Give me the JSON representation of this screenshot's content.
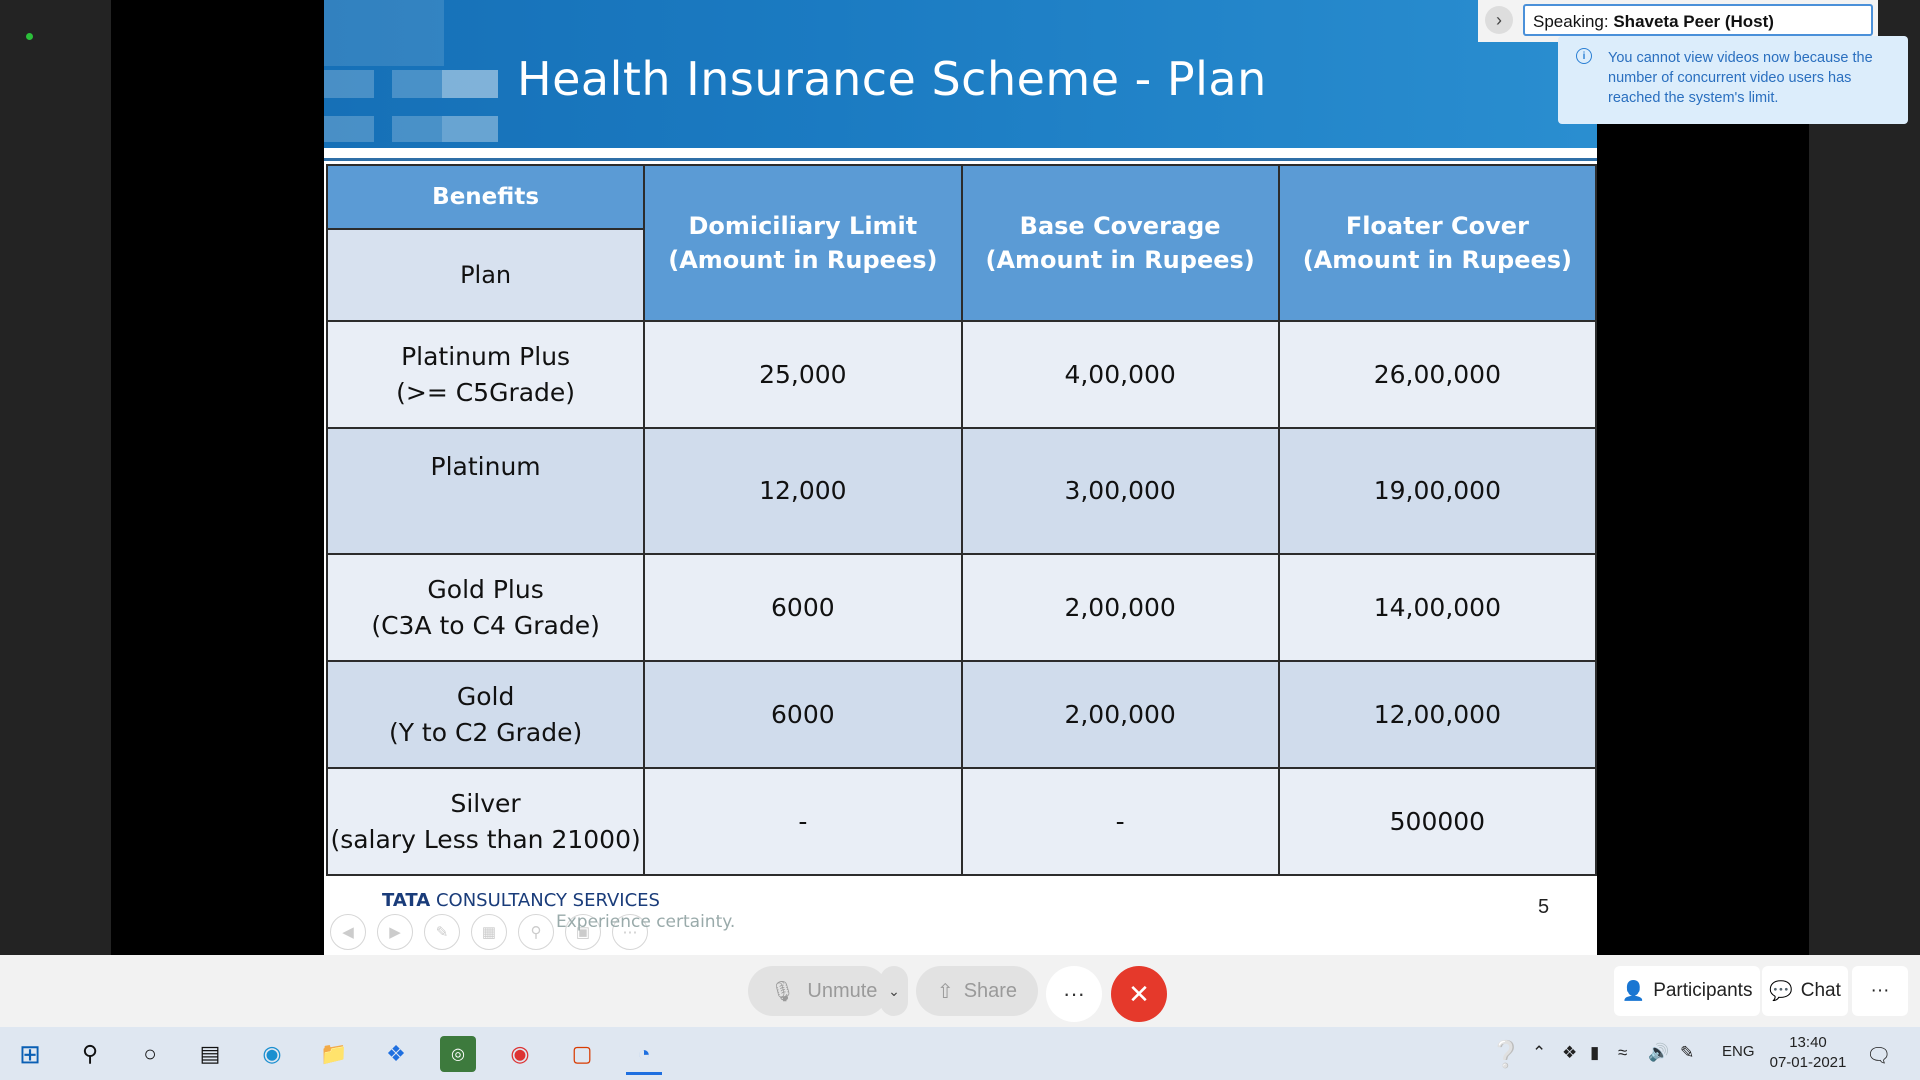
{
  "slide": {
    "title": "Health Insurance Scheme - Plan",
    "table": {
      "header_benefits": "Benefits",
      "header_plan": "Plan",
      "columns": [
        [
          "Domiciliary Limit",
          "(Amount in Rupees)"
        ],
        [
          "Base Coverage",
          "(Amount in Rupees)"
        ],
        [
          "Floater Cover",
          "(Amount in Rupees)"
        ]
      ],
      "rows": [
        {
          "plan": [
            "Platinum Plus",
            "(>= C5Grade)"
          ],
          "values": [
            "25,000",
            "4,00,000",
            "26,00,000"
          ]
        },
        {
          "plan": [
            "Platinum",
            ""
          ],
          "values": [
            "12,000",
            "3,00,000",
            "19,00,000"
          ]
        },
        {
          "plan": [
            "Gold Plus",
            "(C3A to C4 Grade)"
          ],
          "values": [
            "6000",
            "2,00,000",
            "14,00,000"
          ]
        },
        {
          "plan": [
            "Gold",
            "(Y to C2 Grade)"
          ],
          "values": [
            "6000",
            "2,00,000",
            "12,00,000"
          ]
        },
        {
          "plan": [
            "Silver",
            "(salary Less than 21000)"
          ],
          "values": [
            "-",
            "-",
            "500000"
          ]
        }
      ]
    },
    "footer_brand_bold": "TATA",
    "footer_brand": "CONSULTANCY SERVICES",
    "footer_tagline": "Experience certainty.",
    "page_number": "5"
  },
  "speaking": {
    "prefix": "Speaking: ",
    "name": "Shaveta Peer (Host)"
  },
  "notice": "You cannot view videos now because the number of concurrent video users has reached the system's limit.",
  "meeting_bar": {
    "unmute": "Unmute",
    "share": "Share",
    "more": "···",
    "participants": "Participants",
    "chat": "Chat",
    "overflow": "···"
  },
  "taskbar": {
    "language": "ENG",
    "time": "13:40",
    "date": "07-01-2021"
  },
  "colors": {
    "table_header": "#5b9bd5",
    "row_light": "#e9eef6",
    "row_dark": "#d0dcec",
    "end_call": "#e5392b"
  }
}
